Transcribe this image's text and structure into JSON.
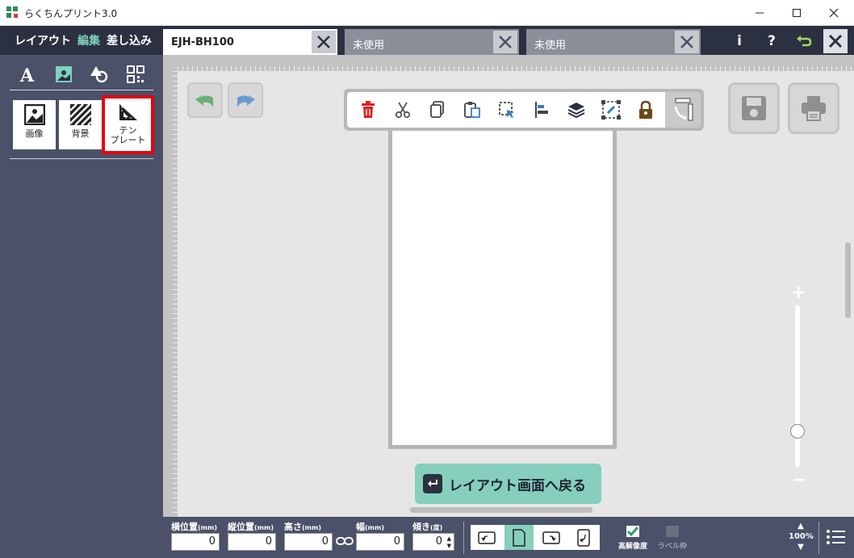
{
  "window": {
    "title": "らくちんプリント3.0",
    "min_icon": "minimize-icon",
    "max_icon": "maximize-icon",
    "close_icon": "close-icon"
  },
  "mode_tabs": [
    {
      "label": "レイアウト",
      "active": false
    },
    {
      "label": "編集",
      "active": true
    },
    {
      "label": "差し込み",
      "active": false
    }
  ],
  "tool_icons": [
    "text-icon",
    "image-icon",
    "shapes-icon",
    "qrcode-icon"
  ],
  "cards": [
    {
      "label_line1": "画像",
      "label_line2": "",
      "icon": "image-icon",
      "selected": false
    },
    {
      "label_line1": "背景",
      "label_line2": "",
      "icon": "background-icon",
      "selected": false
    },
    {
      "label_line1": "テン",
      "label_line2": "プレート",
      "icon": "template-ruler-icon",
      "selected": true
    }
  ],
  "doc_tabs": [
    {
      "label": "EJH-BH100",
      "active": true
    },
    {
      "label": "未使用",
      "active": false
    },
    {
      "label": "未使用",
      "active": false
    }
  ],
  "top_buttons": {
    "info": "i",
    "help": "?"
  },
  "floating_toolbar": [
    "delete-icon",
    "cut-icon",
    "copy-icon",
    "paste-icon",
    "select-area-icon",
    "align-left-icon",
    "layers-icon",
    "group-link-icon",
    "lock-icon",
    "rotate-page-icon"
  ],
  "back_button": {
    "label": "レイアウト画面へ戻る"
  },
  "zoom": {
    "plus": "+",
    "minus": "−",
    "level_fraction": 0.22
  },
  "fields": [
    {
      "label": "横位置",
      "unit": "(mm)",
      "value": "0"
    },
    {
      "label": "縦位置",
      "unit": "(mm)",
      "value": "0"
    },
    {
      "label": "高さ",
      "unit": "(mm)",
      "value": "0"
    },
    {
      "label": "幅",
      "unit": "(mm)",
      "value": "0"
    },
    {
      "label": "傾き",
      "unit": "(度)",
      "value": "0"
    }
  ],
  "options": {
    "high_res": {
      "label": "高解像度",
      "checked": true
    },
    "label_frame": {
      "label": "ラベル枠",
      "checked": false
    }
  },
  "zoom_readout": "100%",
  "colors": {
    "dark": "#2b3140",
    "panel": "#4a5168",
    "accent": "#86cfbd",
    "highlight": "#e8000d"
  }
}
